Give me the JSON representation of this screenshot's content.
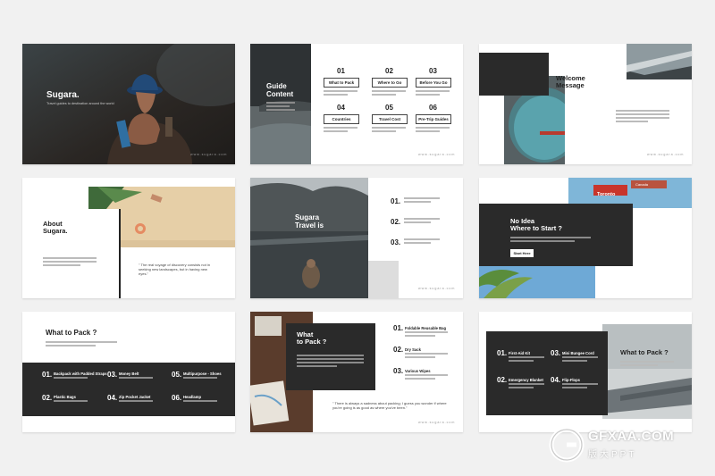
{
  "slide1": {
    "title": "Sugara.",
    "subtitle": "Travel guides to destination around the world",
    "footer": "www.sugara.com"
  },
  "slide2": {
    "title_line1": "Guide",
    "title_line2": "Content",
    "items": [
      {
        "num": "01",
        "label": "What to Pack"
      },
      {
        "num": "02",
        "label": "Where to Go"
      },
      {
        "num": "03",
        "label": "Before You Go"
      },
      {
        "num": "04",
        "label": "Countries"
      },
      {
        "num": "05",
        "label": "Travel Cost"
      },
      {
        "num": "06",
        "label": "Pre-Trip Guides"
      }
    ],
    "footer": "www.sugara.com"
  },
  "slide3": {
    "title_line1": "Welcome",
    "title_line2": "Message",
    "footer": "www.sugara.com"
  },
  "slide4": {
    "title_line1": "About",
    "title_line2": "Sugara.",
    "quote": "\" The real voyage of discovery consists not in seeking new landscapes, but in having new eyes.\""
  },
  "slide5": {
    "title_line1": "Sugara",
    "title_line2": "Travel is",
    "nums": [
      "01.",
      "02.",
      "03."
    ],
    "footer": "www.sugara.com"
  },
  "slide6": {
    "title_line1": "No Idea",
    "title_line2": "Where to Start ?",
    "button": "Start Here",
    "sign1": "Toronto",
    "sign2": "Canada"
  },
  "slide7": {
    "title": "What to Pack ?",
    "items": [
      {
        "num": "01.",
        "label": "Backpack with Padded Straps"
      },
      {
        "num": "03.",
        "label": "Money Belt"
      },
      {
        "num": "05.",
        "label": "Multipurpose - Shoes"
      },
      {
        "num": "02.",
        "label": "Plastic Bags"
      },
      {
        "num": "04.",
        "label": "Zip Pocket Jacket"
      },
      {
        "num": "06.",
        "label": "Headlamp"
      }
    ]
  },
  "slide8": {
    "title_line1": "What",
    "title_line2": "to Pack ?",
    "items": [
      {
        "num": "01.",
        "label": "Foldable Reusable Bag"
      },
      {
        "num": "02.",
        "label": "Dry Sack"
      },
      {
        "num": "03.",
        "label": "Various Wipes"
      }
    ],
    "quote": "\" There is always a sadness about packing; I guess you wonder if where you're going is as good as where you've been.\"",
    "footer": "www.sugara.com"
  },
  "slide9": {
    "title": "What to Pack ?",
    "items": [
      {
        "num": "01.",
        "label": "First-Aid Kit"
      },
      {
        "num": "03.",
        "label": "Mini Bungee Cord"
      },
      {
        "num": "02.",
        "label": "Emergency Blanket"
      },
      {
        "num": "04.",
        "label": "Flip-Flops"
      }
    ]
  },
  "watermark": {
    "brand": "GFXAA.COM",
    "sub": "版大PPT"
  }
}
